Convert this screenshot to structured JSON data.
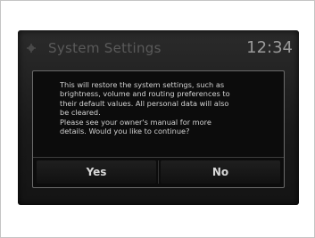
{
  "header": {
    "title": "System Settings",
    "clock": "12:34",
    "icon": "gear-icon"
  },
  "dialog": {
    "message": "This will restore the system settings, such as\nbrightness, volume and routing preferences to\ntheir default values. All personal data will also\nbe cleared.\nPlease see your owner's manual for more\ndetails. Would you like to continue?",
    "yes_label": "Yes",
    "no_label": "No"
  }
}
